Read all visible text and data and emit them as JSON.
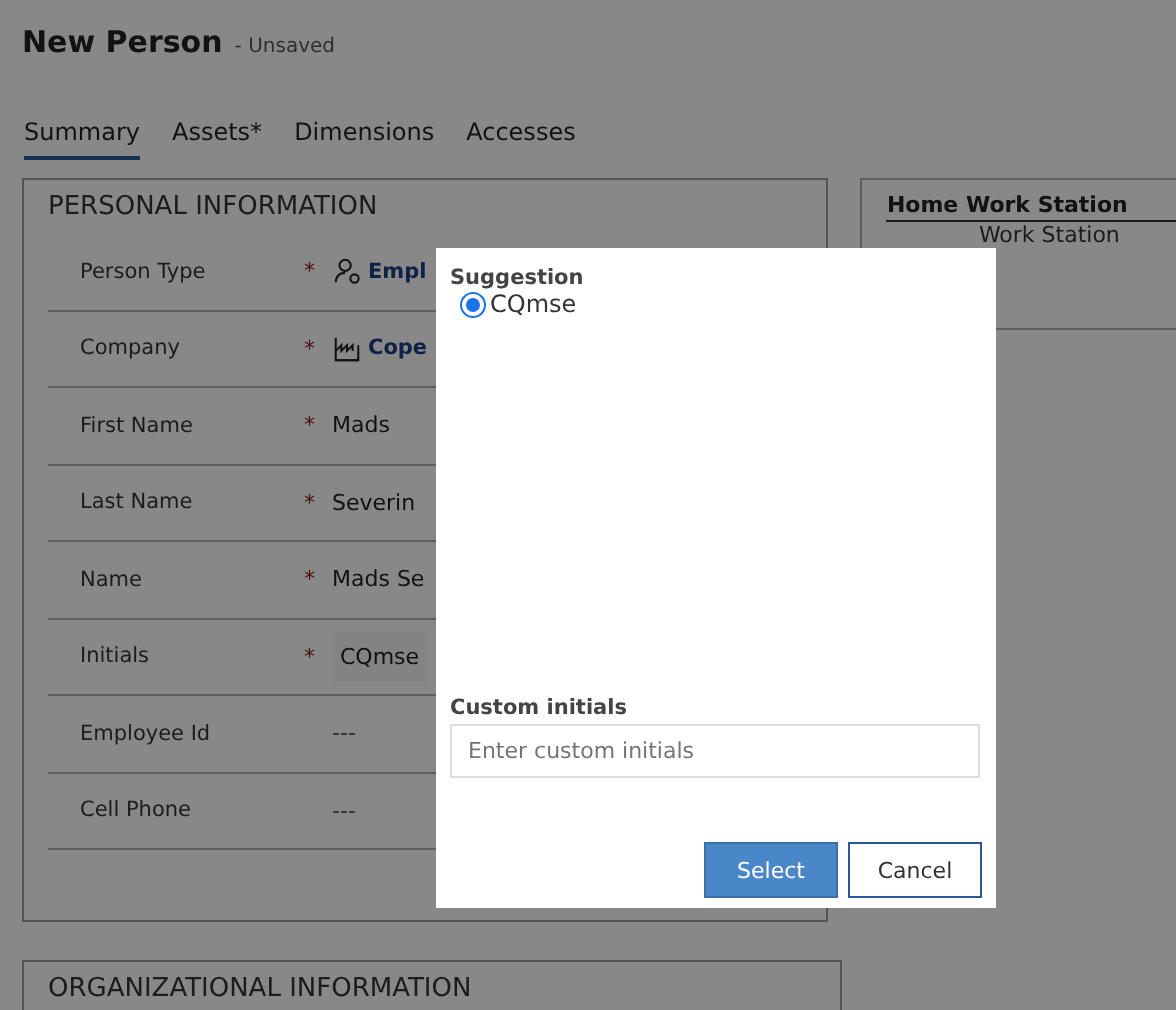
{
  "header": {
    "title": "New Person",
    "status": "- Unsaved"
  },
  "tabs": [
    {
      "label": "Summary",
      "selected": true
    },
    {
      "label": "Assets*",
      "selected": false
    },
    {
      "label": "Dimensions",
      "selected": false
    },
    {
      "label": "Accesses",
      "selected": false
    }
  ],
  "personal_information": {
    "title": "PERSONAL INFORMATION",
    "fields": [
      {
        "label": "Person Type",
        "required_mark": "*",
        "value": "Empl",
        "kind": "person-link"
      },
      {
        "label": "Company",
        "required_mark": "*",
        "value": "Cope",
        "kind": "company-link"
      },
      {
        "label": "First Name",
        "required_mark": "*",
        "value": "Mads",
        "kind": "text"
      },
      {
        "label": "Last Name",
        "required_mark": "*",
        "value": "Severin",
        "kind": "text"
      },
      {
        "label": "Name",
        "required_mark": "*",
        "value": "Mads Se",
        "kind": "text"
      },
      {
        "label": "Initials",
        "required_mark": "*",
        "value": "CQmse",
        "kind": "input"
      },
      {
        "label": "Employee Id",
        "value": "---",
        "kind": "empty"
      },
      {
        "label": "Cell Phone",
        "value": "---",
        "kind": "empty"
      }
    ]
  },
  "organizational_information": {
    "title": "ORGANIZATIONAL INFORMATION"
  },
  "home_work_station": {
    "title": "Home Work Station",
    "option": "Work Station"
  },
  "dialog": {
    "suggestion_label": "Suggestion",
    "suggestions": [
      {
        "label": "CQmse",
        "selected": true
      }
    ],
    "custom_label": "Custom initials",
    "custom_placeholder": "Enter custom initials",
    "buttons": [
      {
        "label": "Select",
        "kind": "primary"
      },
      {
        "label": "Cancel",
        "kind": "secondary"
      }
    ]
  }
}
